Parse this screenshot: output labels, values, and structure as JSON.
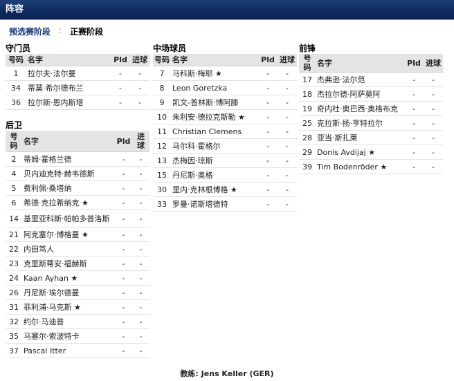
{
  "header": {
    "title": "阵容"
  },
  "tabs": {
    "preseason": "预选赛阶段",
    "separator": ":",
    "main": "正赛阶段"
  },
  "columns": {
    "num": "号码",
    "name": "名字",
    "pld": "Pld",
    "goals": "进球"
  },
  "goalkeepers": {
    "title": "守门员",
    "players": [
      {
        "num": "1",
        "name": "拉尔夫·法尔曼",
        "pld": "-",
        "goals": "-"
      },
      {
        "num": "34",
        "name": "蒂莫·希尔德布兰",
        "pld": "-",
        "goals": "-"
      },
      {
        "num": "36",
        "name": "拉尔斯·恩内斯塔",
        "pld": "-",
        "goals": "-"
      }
    ]
  },
  "defenders": {
    "title": "后卫",
    "players": [
      {
        "num": "2",
        "name": "蒂姆·霍格兰德",
        "pld": "-",
        "goals": "-"
      },
      {
        "num": "4",
        "name": "贝内迪克特·赫韦德斯",
        "pld": "-",
        "goals": "-"
      },
      {
        "num": "5",
        "name": "费利佩·桑塔纳",
        "pld": "-",
        "goals": "-"
      },
      {
        "num": "6",
        "name": "希德·克拉希纳克 ★",
        "pld": "-",
        "goals": "-"
      },
      {
        "num": "14",
        "name": "基里亚科斯·帕帕多普洛斯",
        "pld": "-",
        "goals": "-"
      },
      {
        "num": "21",
        "name": "阿克塞尔·博格曼 ★",
        "pld": "-",
        "goals": "-"
      },
      {
        "num": "22",
        "name": "内田笃人",
        "pld": "-",
        "goals": "-"
      },
      {
        "num": "23",
        "name": "克里斯蒂安·福赫斯",
        "pld": "-",
        "goals": "-"
      },
      {
        "num": "24",
        "name": "Kaan Ayhan ★",
        "pld": "-",
        "goals": "-"
      },
      {
        "num": "26",
        "name": "丹尼斯·埃尔德曼",
        "pld": "-",
        "goals": "-"
      },
      {
        "num": "31",
        "name": "菲利浦·马克斯 ★",
        "pld": "-",
        "goals": "-"
      },
      {
        "num": "32",
        "name": "约尔·马迪普",
        "pld": "-",
        "goals": "-"
      },
      {
        "num": "35",
        "name": "马塞尔·索波特卡",
        "pld": "-",
        "goals": "-"
      },
      {
        "num": "37",
        "name": "Pascal Itter",
        "pld": "-",
        "goals": "-"
      }
    ]
  },
  "midfielders": {
    "title": "中场球员",
    "players": [
      {
        "num": "7",
        "name": "马科斯·梅耶 ★",
        "pld": "-",
        "goals": "-"
      },
      {
        "num": "8",
        "name": "Leon Goretzka",
        "pld": "-",
        "goals": "-"
      },
      {
        "num": "9",
        "name": "凯文-普林斯·博阿滕",
        "pld": "-",
        "goals": "-"
      },
      {
        "num": "10",
        "name": "朱利安·德拉克斯勒 ★",
        "pld": "-",
        "goals": "-"
      },
      {
        "num": "11",
        "name": "Christian Clemens",
        "pld": "-",
        "goals": "-"
      },
      {
        "num": "12",
        "name": "马尔科·霍格尔",
        "pld": "-",
        "goals": "-"
      },
      {
        "num": "13",
        "name": "杰梅因·琼斯",
        "pld": "-",
        "goals": "-"
      },
      {
        "num": "15",
        "name": "丹尼斯·奥格",
        "pld": "-",
        "goals": "-"
      },
      {
        "num": "30",
        "name": "里内·克林根博格 ★",
        "pld": "-",
        "goals": "-"
      },
      {
        "num": "33",
        "name": "罗曼·诺斯塔德特",
        "pld": "-",
        "goals": "-"
      }
    ]
  },
  "forwards": {
    "title": "前锋",
    "players": [
      {
        "num": "17",
        "name": "杰弗逊·法尔范",
        "pld": "-",
        "goals": "-"
      },
      {
        "num": "18",
        "name": "杰拉尔德·阿萨莫阿",
        "pld": "-",
        "goals": "-"
      },
      {
        "num": "19",
        "name": "奇内杜·奥巴西·奥格布克",
        "pld": "-",
        "goals": "-"
      },
      {
        "num": "25",
        "name": "克拉斯·扬·亨特拉尔",
        "pld": "-",
        "goals": "-"
      },
      {
        "num": "28",
        "name": "亚当·斯扎莱",
        "pld": "-",
        "goals": "-"
      },
      {
        "num": "29",
        "name": "Donis Avdijaj ★",
        "pld": "-",
        "goals": "-"
      },
      {
        "num": "39",
        "name": "Tim Bodenröder ★",
        "pld": "-",
        "goals": "-"
      }
    ]
  },
  "coach": {
    "label": "教练:",
    "name": "Jens Keller (GER)"
  }
}
